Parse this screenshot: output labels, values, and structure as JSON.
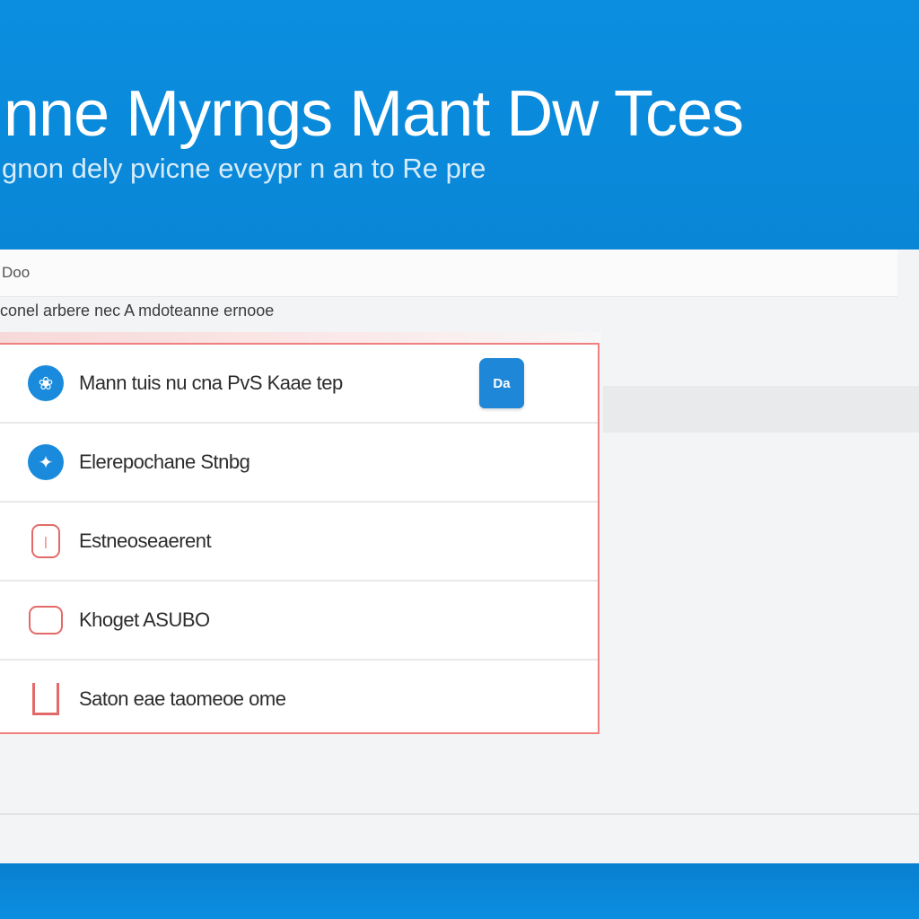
{
  "hero": {
    "title": "nne Myrngs Mant Dw Tces",
    "subtitle": "gnon dely pvicne eveypr n an to Re pre"
  },
  "panel": {
    "label": "Doo",
    "description": "conel arbere nec A mdoteanne ernooe"
  },
  "list": {
    "items": [
      {
        "icon": "blue-round-logo-icon",
        "label": "Mann tuis nu cna PvS Kaae tep",
        "badge": "Da"
      },
      {
        "icon": "blue-shield-icon",
        "label": "Elerepochane Stnbg"
      },
      {
        "icon": "red-outline-box-icon",
        "label": "Estneoseaerent"
      },
      {
        "icon": "red-outline-rect-icon",
        "label": "Khoget ASUBO"
      },
      {
        "icon": "red-bracket-icon",
        "label": "Saton eae taomeoe ome"
      }
    ]
  },
  "colors": {
    "brand_blue": "#0b8ee0",
    "accent_red": "#f07f7f",
    "panel_bg": "#f3f4f5"
  }
}
